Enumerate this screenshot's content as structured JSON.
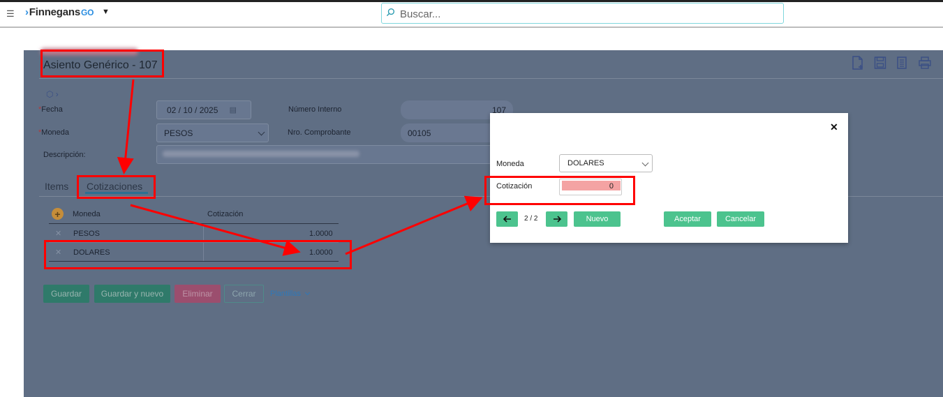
{
  "topbar": {
    "brand": "Finnegans",
    "brand_suffix": "GO",
    "search_placeholder": "Buscar..."
  },
  "document": {
    "title": "Asiento Genérico - 107",
    "fields": {
      "fecha_label": "Fecha",
      "fecha_value": "02 / 10 / 2025",
      "moneda_label": "Moneda",
      "moneda_value": "PESOS",
      "descripcion_label": "Descripción:",
      "numero_interno_label": "Número Interno",
      "numero_interno_value": "107",
      "nro_comprobante_label": "Nro. Comprobante",
      "nro_comprobante_value": "00105"
    },
    "tabs": [
      {
        "label": "Items",
        "active": false
      },
      {
        "label": "Cotizaciones",
        "active": true
      }
    ],
    "table": {
      "headers": [
        "Moneda",
        "Cotización"
      ],
      "rows": [
        {
          "moneda": "PESOS",
          "cotizacion": "1.0000"
        },
        {
          "moneda": "DOLARES",
          "cotizacion": "1.0000"
        }
      ]
    },
    "buttons": {
      "guardar": "Guardar",
      "guardar_nuevo": "Guardar y nuevo",
      "eliminar": "Eliminar",
      "cerrar": "Cerrar",
      "plantillas": "Plantillas"
    }
  },
  "modal": {
    "moneda_label": "Moneda",
    "moneda_value": "DOLARES",
    "cotizacion_label": "Cotización",
    "cotizacion_value": "0",
    "pager": "2 / 2",
    "nuevo": "Nuevo",
    "aceptar": "Aceptar",
    "cancelar": "Cancelar",
    "close_symbol": "✕"
  },
  "colors": {
    "accent_green": "#4cc38e",
    "annotation_red": "#ff0000",
    "overlay": "#5f6e84"
  }
}
